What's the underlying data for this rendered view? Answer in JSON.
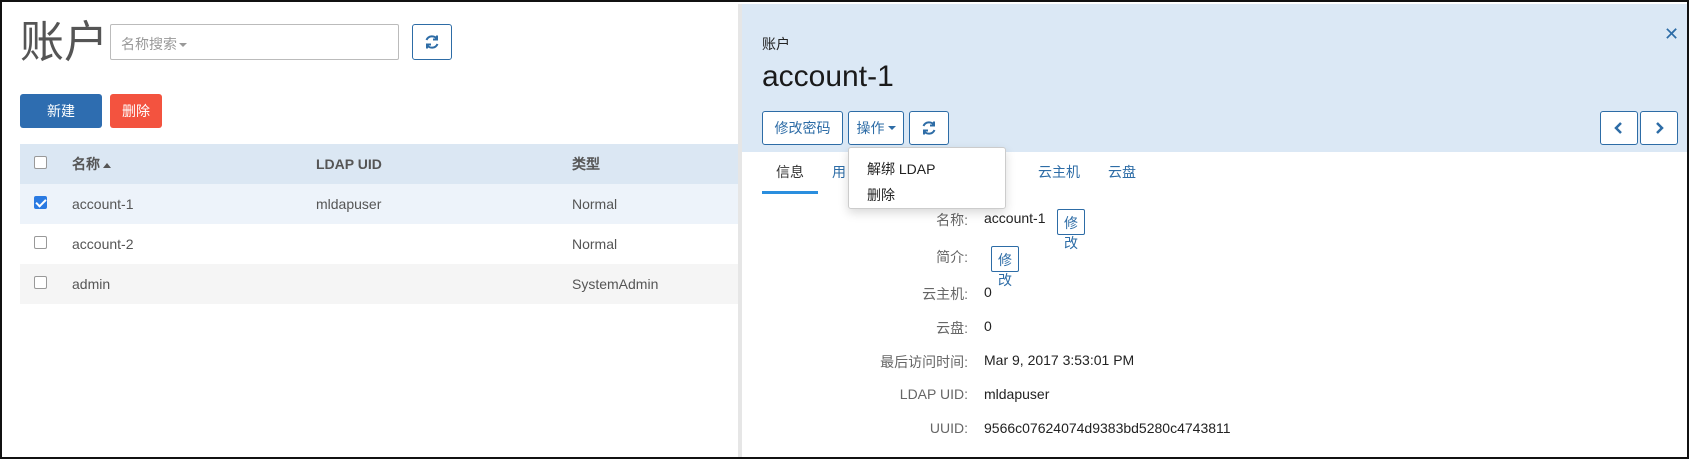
{
  "left": {
    "title": "账户",
    "search": {
      "placeholder": "名称搜索",
      "icon": "chevron-down-icon"
    },
    "refresh_icon": "refresh-icon",
    "buttons": {
      "new": "新建",
      "delete": "删除"
    },
    "table": {
      "columns": [
        "名称",
        "LDAP UID",
        "类型"
      ],
      "rows": [
        {
          "name": "account-1",
          "ldap_uid": "mldapuser",
          "type": "Normal",
          "checked": true
        },
        {
          "name": "account-2",
          "ldap_uid": "",
          "type": "Normal",
          "checked": false
        },
        {
          "name": "admin",
          "ldap_uid": "",
          "type": "SystemAdmin",
          "checked": false
        }
      ]
    }
  },
  "right": {
    "breadcrumb": "账户",
    "title": "account-1",
    "close_icon": "close-icon",
    "actions": {
      "change_password": "修改密码",
      "operations": "操作"
    },
    "dropdown": [
      "解绑 LDAP",
      "删除"
    ],
    "tabs": [
      "信息",
      "用",
      "云主机",
      "云盘"
    ],
    "info": {
      "name_label": "名称:",
      "name_value": "account-1",
      "desc_label": "简介:",
      "vm_label": "云主机:",
      "vm_value": "0",
      "disk_label": "云盘:",
      "disk_value": "0",
      "last_access_label": "最后访问时间:",
      "last_access_value": "Mar 9, 2017 3:53:01 PM",
      "ldap_label": "LDAP UID:",
      "ldap_value": "mldapuser",
      "uuid_label": "UUID:",
      "uuid_value": "9566c07624074d9383bd5280c4743811",
      "edit": "修改"
    }
  },
  "colors": {
    "primary": "#2e6db0",
    "danger": "#f3533f",
    "header_bg": "#dbe8f5",
    "link": "#2d6ca6"
  }
}
